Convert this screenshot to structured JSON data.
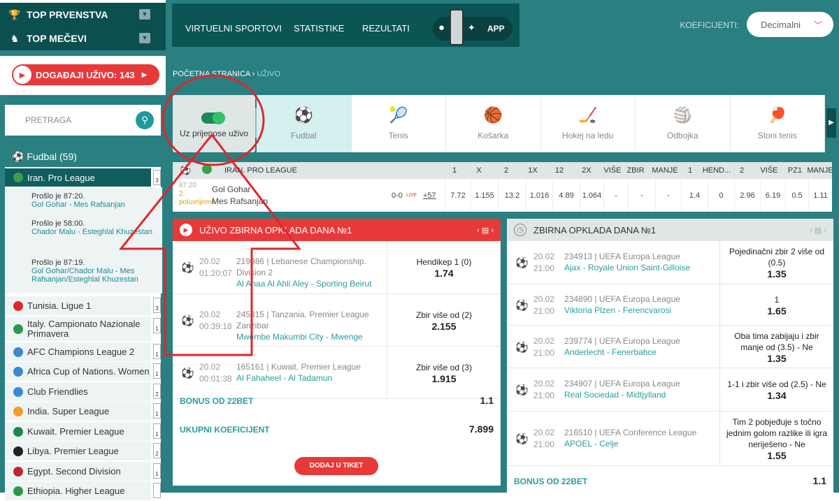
{
  "sidebar": {
    "top_championships": "TOP PRVENSTVA",
    "top_matches": "TOP MEČEVI",
    "live_button": "DOGAĐAJI UŽIVO: 143",
    "search_placeholder": "PRETRAGA",
    "sport_header": "Fudbal (59)",
    "leagues": [
      {
        "name": "Iran. Pro League",
        "count": "3",
        "flag": "#3aa04a"
      },
      {
        "name": "Tunisia. Ligue 1",
        "count": "3",
        "flag": "#e0262b"
      },
      {
        "name": "Italy. Campionato Nazionale Primavera",
        "count": "1",
        "flag": "#2a9a4a"
      },
      {
        "name": "AFC Champions League 2",
        "count": "1",
        "flag": "#3a8ad0"
      },
      {
        "name": "Africa Cup of Nations. Women",
        "count": "1",
        "flag": "#3a8ad0"
      },
      {
        "name": "Club Friendlies",
        "count": "2",
        "flag": "#3a8ad0"
      },
      {
        "name": "India. Super League",
        "count": "1",
        "flag": "#f29a2a"
      },
      {
        "name": "Kuwait. Premier League",
        "count": "1",
        "flag": "#1a8a4a"
      },
      {
        "name": "Libya. Premier League",
        "count": "2",
        "flag": "#222222"
      },
      {
        "name": "Egypt. Second Division",
        "count": "1",
        "flag": "#c0262b"
      },
      {
        "name": "Ethiopia. Higher League",
        "count": "",
        "flag": "#2a9a4a"
      }
    ],
    "events": [
      {
        "time": "Prošlo je 87:20.",
        "match": "Gol Gohar - Mes Rafsanjan"
      },
      {
        "time": "Prošlo je 58:00.",
        "match": "Chador Malu - Esteghlal Khuzestan"
      },
      {
        "time": "Prošlo je 87:19.",
        "match": "Gol Gohar/Chador Malu - Mes Rafsanjan/Esteghlal Khuzestan"
      }
    ]
  },
  "topbar": {
    "nav": [
      "VIRTUELNI SPORTOVI",
      "STATISTIKE",
      "REZULTATI"
    ],
    "app_label": "APP",
    "odds_label": "KOEFICIJENTI:",
    "odds_format": "Decimalni"
  },
  "breadcrumb": {
    "home": "POČETNA STRANICA",
    "separator": "›",
    "current": "UŽIVO"
  },
  "live_toggle_label": "Uz prijenose uživo",
  "sports": [
    {
      "name": "Fudbal",
      "icon": "⚽"
    },
    {
      "name": "Tenis",
      "icon": "🎾"
    },
    {
      "name": "Košarka",
      "icon": "🏀"
    },
    {
      "name": "Hokej na ledu",
      "icon": "🏒"
    },
    {
      "name": "Odbojka",
      "icon": "🏐"
    },
    {
      "name": "Stoni tenis",
      "icon": "🏓"
    }
  ],
  "match_table": {
    "league": "IRAN. PRO LEAGUE",
    "headers": [
      "1",
      "X",
      "2",
      "1X",
      "12",
      "2X",
      "VIŠE",
      "ZBIR",
      "MANJE",
      "1",
      "HEND...",
      "2",
      "VIŠE",
      "PZ1",
      "MANJE"
    ],
    "row": {
      "time": "87:20",
      "period": "2. poluvrijeme",
      "home": "Gol Gohar",
      "away": "Mes Rafsanjan",
      "score": "0-0",
      "live": "LIVE",
      "more": "+57",
      "odds": [
        "7.72",
        "1.155",
        "13.2",
        "1.016",
        "4.89",
        "1.064",
        "-",
        "-",
        "-",
        "1.4",
        "0",
        "2.96",
        "6.19",
        "0.5",
        "1.11"
      ]
    }
  },
  "live_accumulator": {
    "title": "UŽIVO ZBIRNA OPKLADA DANA №1",
    "rows": [
      {
        "date": "20.02",
        "time": "01:20:07",
        "info": "219986 | Lebanese Championship. Division 2",
        "home": "Al Ahaa Al Ahli Aley",
        "away": "Sporting Beirut",
        "bet": "Hendikep 1 (0)",
        "odd": "1.74"
      },
      {
        "date": "20.02",
        "time": "00:39:18",
        "info": "245815 | Tanzania. Premier League Zanzibar",
        "home": "Mwembe Makumbi City",
        "away": "Mwenge",
        "bet": "Zbir više od (2)",
        "odd": "2.155"
      },
      {
        "date": "20.02",
        "time": "00:01:38",
        "info": "165161 | Kuwait. Premier League",
        "home": "Al Fahaheel",
        "away": "Al Tadamun",
        "bet": "Zbir više od (3)",
        "odd": "1.915"
      }
    ],
    "bonus_label": "BONUS OD 22BET",
    "bonus_value": "1.1",
    "total_label": "UKUPNI KOEFICIJENT",
    "total_value": "7.899",
    "add_button": "DODAJ U TIKET"
  },
  "daily_accumulator": {
    "title": "ZBIRNA OPKLADA DANA №1",
    "rows": [
      {
        "date": "20.02",
        "time": "21:00",
        "info": "234913 | UEFA Europa League",
        "home": "Ajax",
        "away": "Royale Union Saint-Gilloise",
        "bet": "Pojedinačni zbir 2 više od (0.5)",
        "odd": "1.35"
      },
      {
        "date": "20.02",
        "time": "21:00",
        "info": "234890 | UEFA Europa League",
        "home": "Viktoria Plzen",
        "away": "Ferencvarosi",
        "bet": "1",
        "odd": "1.65"
      },
      {
        "date": "20.02",
        "time": "21:00",
        "info": "239774 | UEFA Europa League",
        "home": "Anderlecht",
        "away": "Fenerbahce",
        "bet": "Oba tima zabijaju i zbir manje od (3.5) - Ne",
        "odd": "1.35"
      },
      {
        "date": "20.02",
        "time": "21:00",
        "info": "234907 | UEFA Europa League",
        "home": "Real Sociedad",
        "away": "Midtjylland",
        "bet": "1-1 i zbir više od (2.5) - Ne",
        "odd": "1.34"
      },
      {
        "date": "20.02",
        "time": "21:00",
        "info": "216510 | UEFA Conference League",
        "home": "APOEL",
        "away": "Celje",
        "bet": "Tim 2 pobjeđuje s točno jednim golom razlike ili igra neriješeno - Ne",
        "odd": "1.55"
      }
    ],
    "bonus_label": "BONUS OD 22BET",
    "bonus_value": "1.1"
  },
  "colors": {
    "teal": "#2a7f80",
    "dark_teal": "#0b4f4f",
    "accent_red": "#e8393a",
    "annotation_red": "#e0262b"
  }
}
